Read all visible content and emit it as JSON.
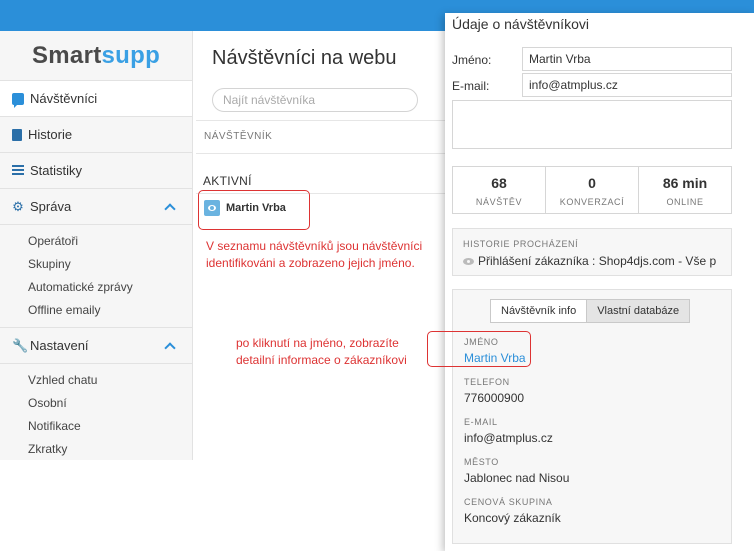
{
  "logo": {
    "part1": "Smart",
    "part2": "supp"
  },
  "sidebar": {
    "items": [
      {
        "label": "Návštěvníci",
        "icon": "chat-icon"
      },
      {
        "label": "Historie",
        "icon": "book-icon"
      },
      {
        "label": "Statistiky",
        "icon": "stats-icon"
      },
      {
        "label": "Správa",
        "icon": "gear-icon"
      },
      {
        "label": "Nastavení",
        "icon": "wrench-icon"
      }
    ],
    "sprava_sub": [
      "Operátoři",
      "Skupiny",
      "Automatické zprávy",
      "Offline emaily"
    ],
    "nastaveni_sub": [
      "Vzhled chatu",
      "Osobní",
      "Notifikace",
      "Zkratky"
    ]
  },
  "main": {
    "title": "Návštěvníci na webu",
    "search_placeholder": "Najít návštěvníka",
    "column_header": "NÁVŠTĚVNÍK",
    "section_label": "AKTIVNÍ",
    "visitor_name": "Martin Vrba"
  },
  "annotations": {
    "list_note_line1": "V seznamu návštěvníků jsou návštěvníci",
    "list_note_line2": "identifikováni a zobrazeno jejich jméno.",
    "click_note_line1": "po kliknutí na jméno, zobrazíte",
    "click_note_line2": "detailní informace o zákazníkovi"
  },
  "panel": {
    "title": "Údaje o návštěvníkovi",
    "name_label": "Jméno:",
    "name_value": "Martin Vrba",
    "email_label": "E-mail:",
    "email_value": "info@atmplus.cz",
    "stats": [
      {
        "value": "68",
        "label": "NÁVŠTĚV"
      },
      {
        "value": "0",
        "label": "KONVERZACÍ"
      },
      {
        "value": "86 min",
        "label": "ONLINE"
      }
    ],
    "history_head": "HISTORIE PROCHÁZENÍ",
    "history_item": "Přihlášení zákazníka : Shop4djs.com - Vše p",
    "tabs": [
      "Návštěvník info",
      "Vlastní databáze"
    ],
    "details": [
      {
        "label": "JMÉNO",
        "value": "Martin Vrba"
      },
      {
        "label": "TELEFON",
        "value": "776000900"
      },
      {
        "label": "E-MAIL",
        "value": "info@atmplus.cz"
      },
      {
        "label": "MĚSTO",
        "value": "Jablonec nad Nisou"
      },
      {
        "label": "CENOVÁ SKUPINA",
        "value": "Koncový zákazník"
      }
    ]
  },
  "colors": {
    "accent": "#2b8fd9",
    "annotation": "#dd3333"
  }
}
